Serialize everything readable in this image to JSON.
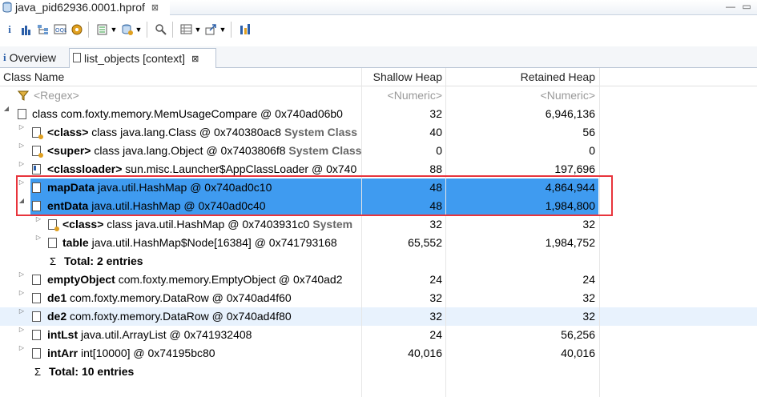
{
  "editor": {
    "title": "java_pid62936.0001.hprof",
    "close": "⊠"
  },
  "toolbar": {
    "icons": [
      "info-icon",
      "histogram-icon",
      "dominator-tree-icon",
      "oql-icon",
      "thread-icon",
      "query-browser-icon",
      "heap-dump-overview-icon",
      "search-icon",
      "group-by-icon",
      "export-icon",
      "calculate-retained-icon"
    ]
  },
  "tabs": [
    {
      "label": "Overview"
    },
    {
      "label": "list_objects [context]"
    }
  ],
  "columns": [
    "Class Name",
    "Shallow Heap",
    "Retained Heap"
  ],
  "filter": {
    "name": "<Regex>",
    "shallow": "<Numeric>",
    "retained": "<Numeric>"
  },
  "rows": [
    {
      "name": "class com.foxty.memory.MemUsageCompare @ 0x740ad06b0",
      "shallow": "32",
      "retained": "6,946,136"
    },
    {
      "bold": "<class>",
      "name": " class java.lang.Class @ 0x740380ac8 ",
      "extra": "System Class",
      "shallow": "40",
      "retained": "56"
    },
    {
      "bold": "<super>",
      "name": " class java.lang.Object @ 0x7403806f8 ",
      "extra": "System Class",
      "shallow": "0",
      "retained": "0"
    },
    {
      "bold": "<classloader>",
      "name": " sun.misc.Launcher$AppClassLoader @ 0x740",
      "shallow": "88",
      "retained": "197,696"
    },
    {
      "bold": "mapData",
      "name": " java.util.HashMap @ 0x740ad0c10",
      "shallow": "48",
      "retained": "4,864,944"
    },
    {
      "bold": "entData",
      "name": " java.util.HashMap @ 0x740ad0c40",
      "shallow": "48",
      "retained": "1,984,800"
    },
    {
      "bold": "<class>",
      "name": " class java.util.HashMap @ 0x7403931c0 ",
      "extra": "System",
      "shallow": "32",
      "retained": "32"
    },
    {
      "bold": "table",
      "name": " java.util.HashMap$Node[16384] @ 0x741793168",
      "shallow": "65,552",
      "retained": "1,984,752"
    },
    {
      "total": "Total: 2 entries"
    },
    {
      "bold": "emptyObject",
      "name": " com.foxty.memory.EmptyObject @ 0x740ad2",
      "shallow": "24",
      "retained": "24"
    },
    {
      "bold": "de1",
      "name": " com.foxty.memory.DataRow @ 0x740ad4f60",
      "shallow": "32",
      "retained": "32"
    },
    {
      "bold": "de2",
      "name": " com.foxty.memory.DataRow @ 0x740ad4f80",
      "shallow": "32",
      "retained": "32"
    },
    {
      "bold": "intLst",
      "name": " java.util.ArrayList @ 0x741932408",
      "shallow": "24",
      "retained": "56,256"
    },
    {
      "bold": "intArr",
      "name": " int[10000] @ 0x74195bc80",
      "shallow": "40,016",
      "retained": "40,016"
    },
    {
      "total": "Total: 10 entries"
    }
  ]
}
